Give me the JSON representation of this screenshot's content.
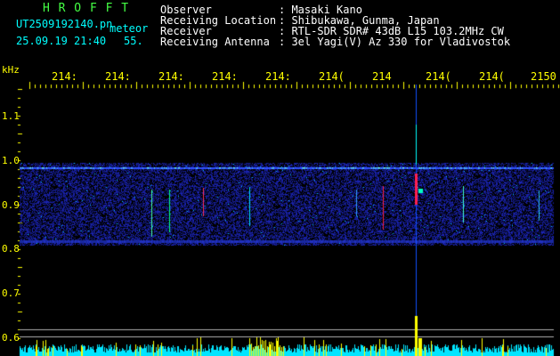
{
  "header": {
    "brand": "H R O F F T",
    "filename": "UT2509192140.pn",
    "mode": "meteor",
    "datetime": "25.09.19 21:40",
    "seconds": "55.",
    "fields": [
      {
        "label": "Observer",
        "value": ": Masaki Kano"
      },
      {
        "label": "Receiving Location",
        "value": ": Shibukawa, Gunma, Japan"
      },
      {
        "label": "Receiver",
        "value": ": RTL-SDR SDR# 43dB L15 103.2MHz CW"
      },
      {
        "label": "Receiving Antenna",
        "value": ": 3el Yagi(V) Az 330 for Vladivostok"
      }
    ]
  },
  "axes": {
    "y_unit": "kHz",
    "y_ticks": [
      "1.1",
      "1.0",
      "0.9",
      "0.8",
      "0.7",
      "0.6"
    ],
    "x_ticks": [
      "214:",
      "214:",
      "214:",
      "214:",
      "214:",
      "214(",
      "214",
      "214(",
      "214(",
      "2150"
    ]
  },
  "colors": {
    "background": "#000000",
    "text": "#ffffff",
    "tick_labels": "#ffff00",
    "brand": "#44ff44",
    "band": "#1a1aa0",
    "noise_floor": "#00e5ff"
  }
}
